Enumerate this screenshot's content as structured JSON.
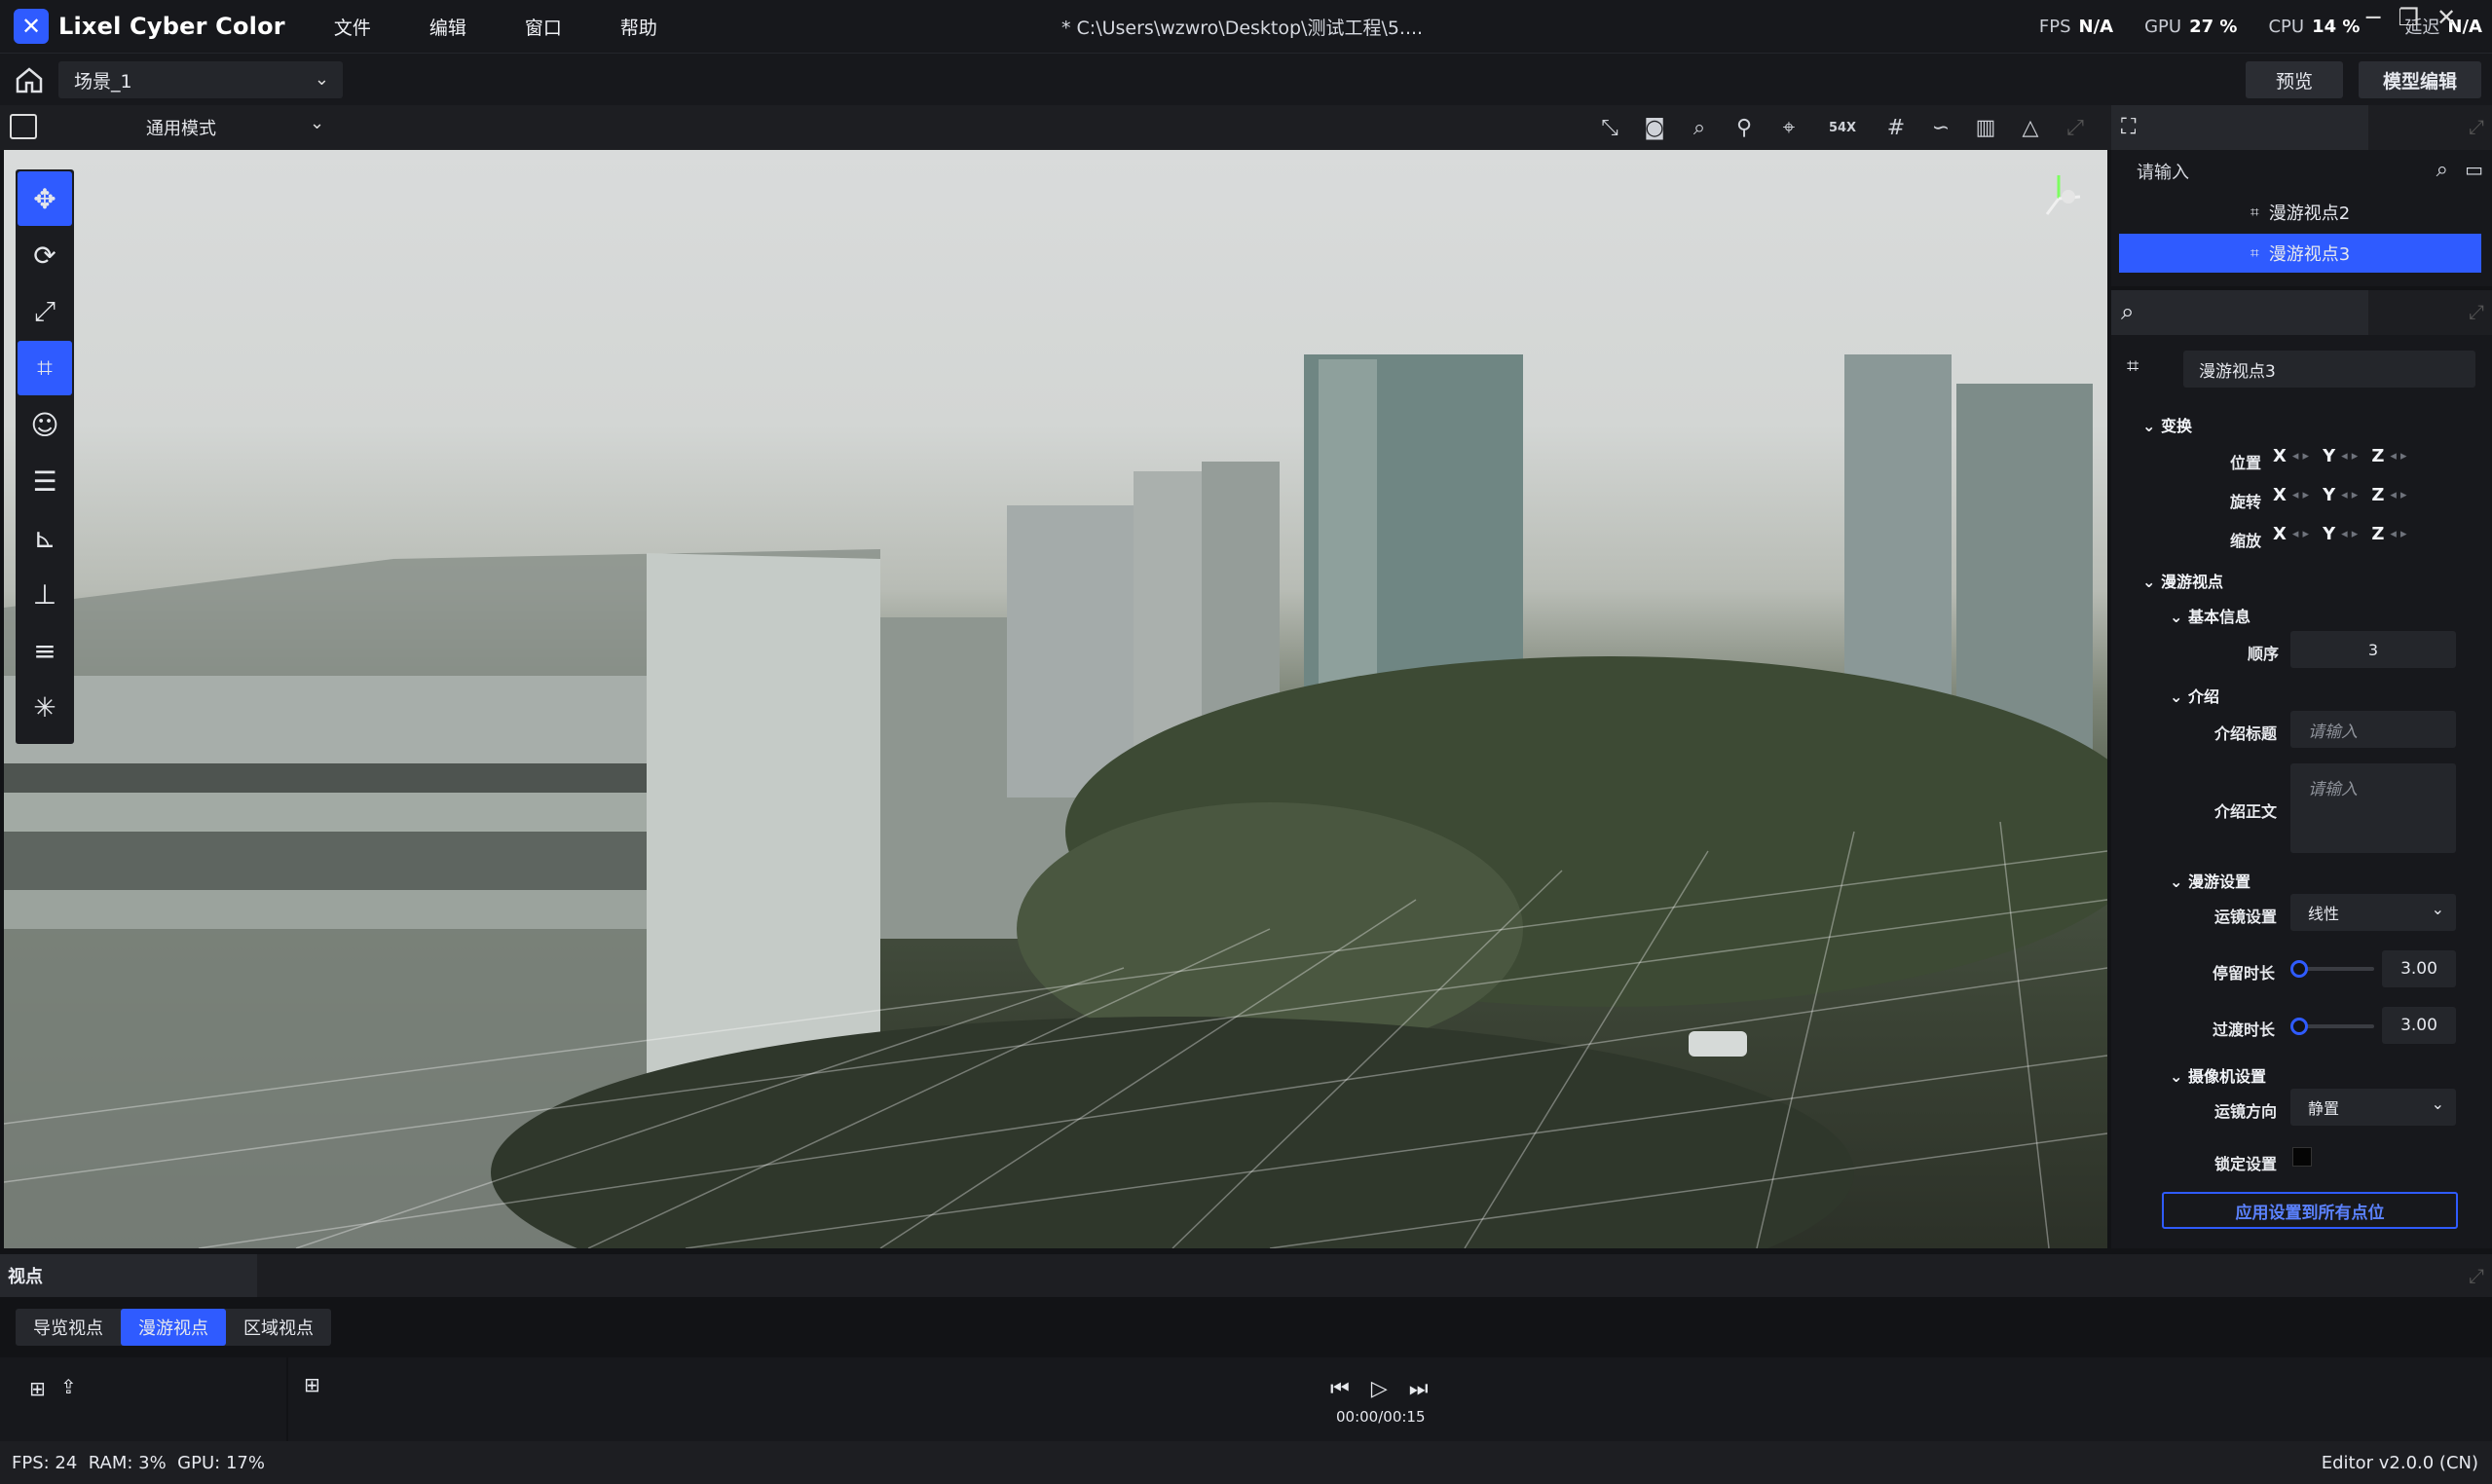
{
  "app": {
    "name": "Lixel Cyber Color",
    "file_path": "* C:\\Users\\wzwro\\Desktop\\测试工程\\5....",
    "accent": "#2f5bff"
  },
  "menu": [
    "文件",
    "编辑",
    "窗口",
    "帮助"
  ],
  "perf": {
    "fps_label": "FPS",
    "fps": "N/A",
    "gpu_label": "GPU",
    "gpu": "27 %",
    "cpu_label": "CPU",
    "cpu": "14 %",
    "latency_label": "延迟",
    "latency": "N/A"
  },
  "scene": {
    "selected": "场景_1"
  },
  "header_buttons": {
    "preview": "预览",
    "model_edit": "模型编辑"
  },
  "viewport": {
    "mode": "通用模式",
    "tool_badge": "54X"
  },
  "tree": {
    "search_placeholder": "请输入",
    "items": [
      {
        "label": "漫游视点2",
        "selected": false
      },
      {
        "label": "漫游视点3",
        "selected": true
      }
    ]
  },
  "props": {
    "name": "漫游视点3",
    "transform": {
      "title": "变换",
      "position": "位置",
      "rotation": "旋转",
      "scale": "缩放",
      "x": "X",
      "y": "Y",
      "z": "Z"
    },
    "roam": {
      "title": "漫游视点",
      "basic": {
        "title": "基本信息",
        "order_label": "顺序",
        "order": "3"
      },
      "intro": {
        "title": "介绍",
        "title_label": "介绍标题",
        "title_placeholder": "请输入",
        "body_label": "介绍正文",
        "body_placeholder": "请输入"
      },
      "roam_settings": {
        "title": "漫游设置",
        "motion_label": "运镜设置",
        "motion": "线性",
        "stay_label": "停留时长",
        "stay": "3.00",
        "transit_label": "过渡时长",
        "transit": "3.00"
      },
      "camera": {
        "title": "摄像机设置",
        "direction_label": "运镜方向",
        "direction": "静置",
        "lock_label": "锁定设置",
        "locked": false
      },
      "apply_button": "应用设置到所有点位"
    }
  },
  "bottom": {
    "title": "视点",
    "tabs": [
      {
        "label": "导览视点",
        "active": false
      },
      {
        "label": "漫游视点",
        "active": true
      },
      {
        "label": "区域视点",
        "active": false
      }
    ],
    "time": "00:00/00:15"
  },
  "status": {
    "left": "FPS: 24  RAM: 3%  GPU: 17%",
    "right": "Editor v2.0.0 (CN)"
  }
}
